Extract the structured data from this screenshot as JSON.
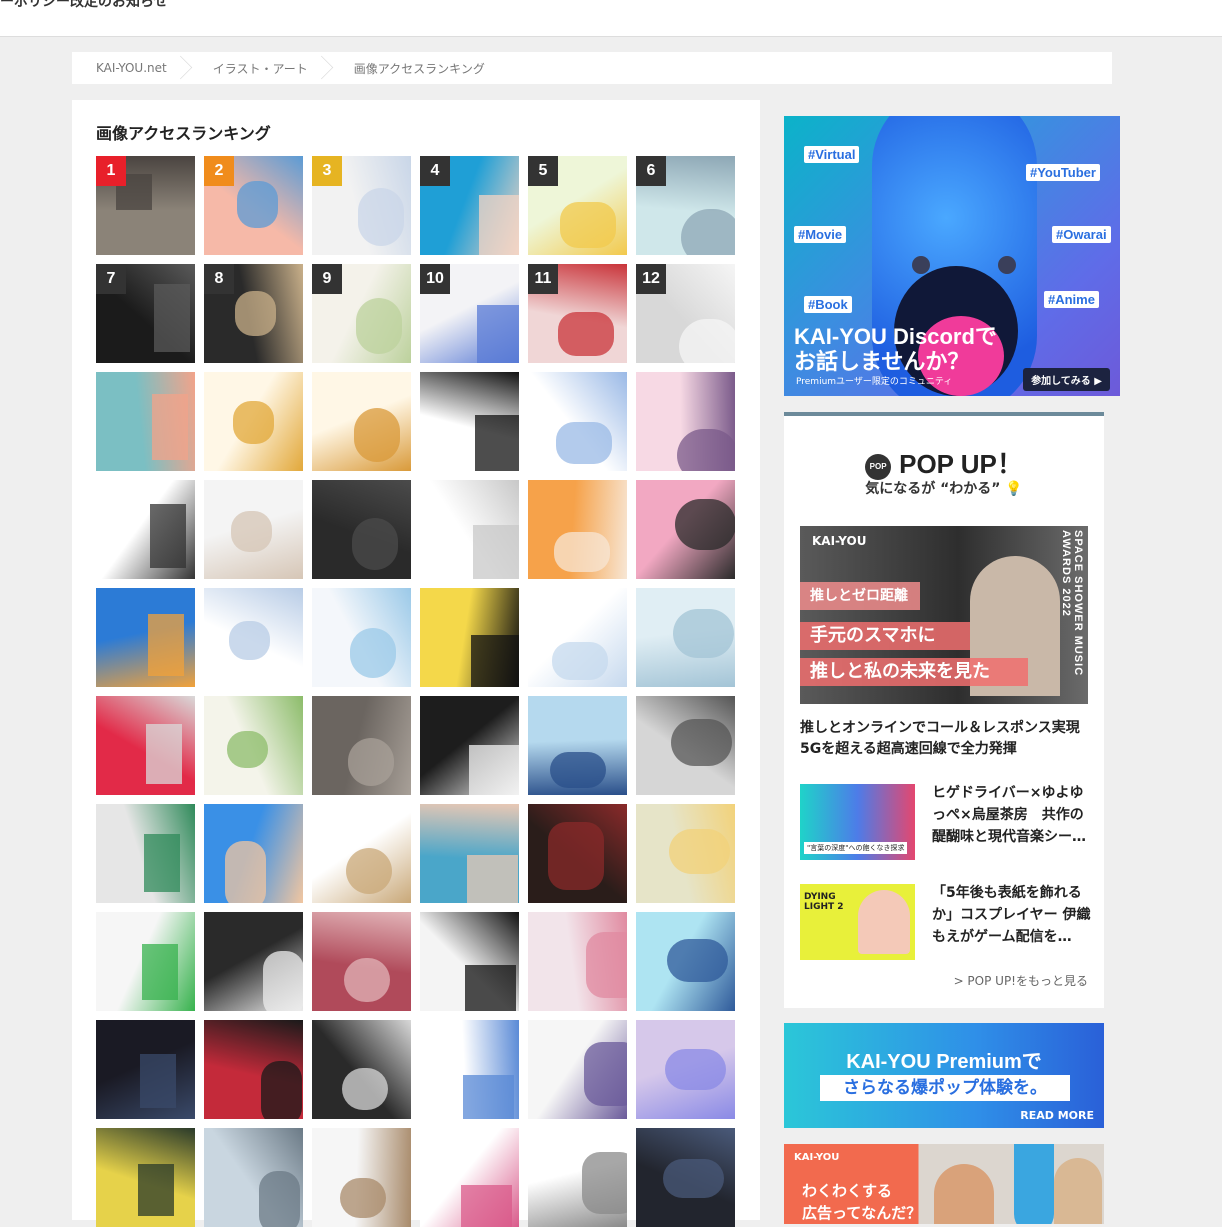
{
  "top_notice": "ーポリシー改定のお知らせ",
  "breadcrumb": [
    "KAI-YOU.net",
    "イラスト・アート",
    "画像アクセスランキング"
  ],
  "ranking": {
    "title": "画像アクセスランキング",
    "ranks": [
      "1",
      "2",
      "3",
      "4",
      "5",
      "6",
      "7",
      "8",
      "9",
      "10",
      "11",
      "12"
    ],
    "rank_colors": {
      "1": "#e8202a",
      "2": "#f08c1c",
      "3": "#e6b422",
      "other": "#333333"
    }
  },
  "banner_discord": {
    "tags": [
      "#Virtual",
      "#YouTuber",
      "#Movie",
      "#Owarai",
      "#Book",
      "#Anime"
    ],
    "title_line1": "KAI-YOU Discordで",
    "title_line2": "お話しませんか？",
    "subtitle": "Premiumユーザー限定のコミュニティ",
    "button": "参加してみる"
  },
  "popup": {
    "icon": "POP",
    "heading": "POP UP！",
    "subheading": "気になるが “わかる” 💡",
    "featured": {
      "logo": "KAI-YOU",
      "band1": "推しとゼロ距離",
      "band2": "手元のスマホに",
      "band3": "推しと私の未来を見た",
      "vertical": "SPACE SHOWER MUSIC AWARDS 2022",
      "title": "推しとオンラインでコール＆レスポンス実現 5Gを超える超高速回線で全力発揮"
    },
    "items": [
      {
        "title": "ヒゲドライバー×ゆよゆっぺ×烏屋茶房　共作の醍醐味と現代音楽シー…",
        "thumb_caption": "\"言葉の深度\"への飽くなき探求"
      },
      {
        "title": "「5年後も表紙を飾れるか」コスプレイヤー 伊織もえがゲーム配信を…",
        "thumb_caption": "DYING LIGHT 2"
      }
    ],
    "more": "> POP UP!をもっと見る"
  },
  "banner_premium": {
    "line1": "KAI-YOU Premiumで",
    "line2": "さらなる爆ポップ体験を。",
    "button": "READ MORE"
  },
  "banner_ad": {
    "logo": "KAI-YOU",
    "line1": "わくわくする",
    "line2": "広告ってなんだ？"
  }
}
